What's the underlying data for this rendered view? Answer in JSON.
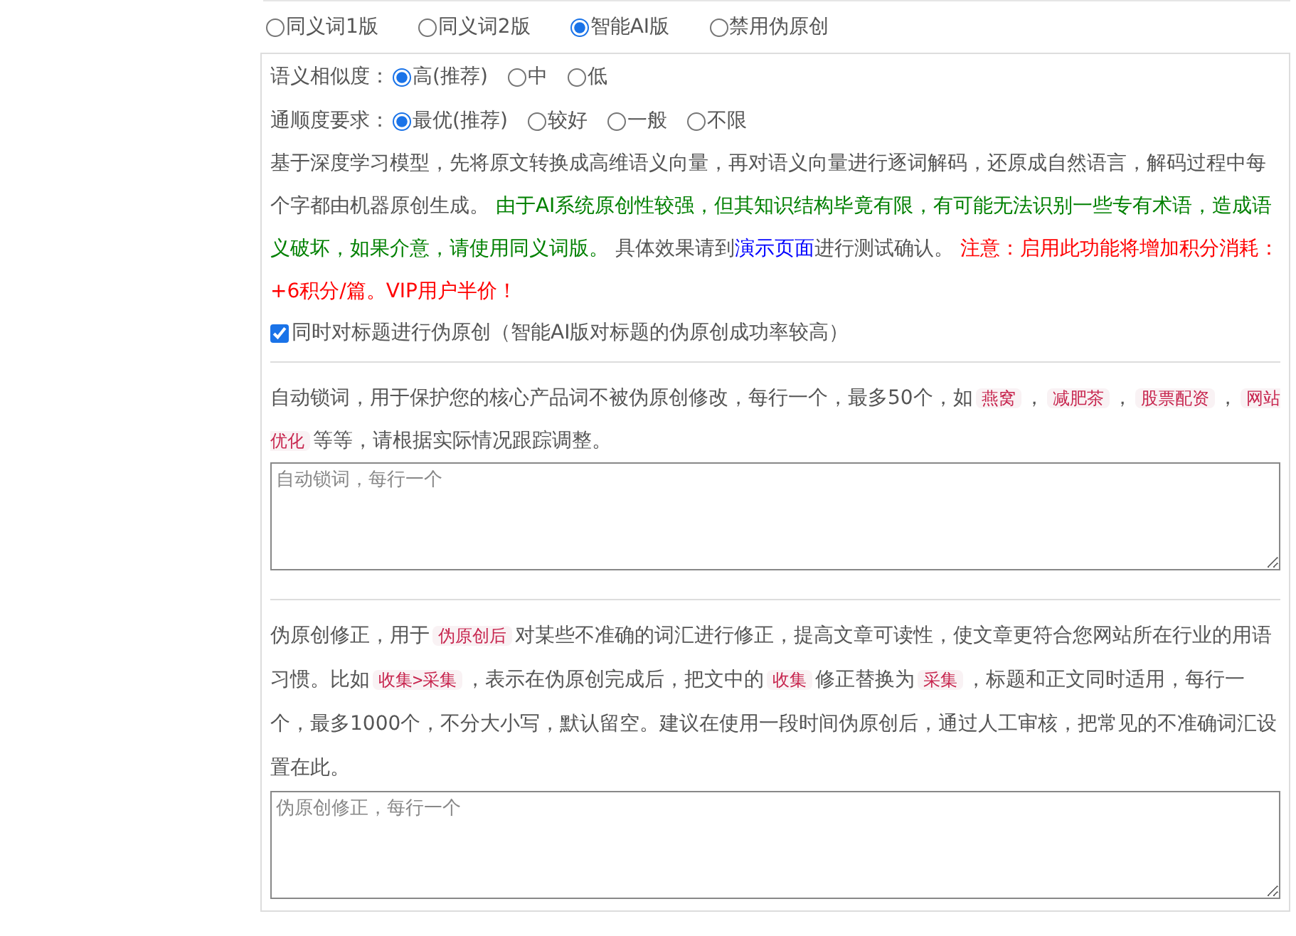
{
  "mode_options": [
    {
      "label": "同义词1版",
      "selected": false
    },
    {
      "label": "同义词2版",
      "selected": false
    },
    {
      "label": "智能AI版",
      "selected": true
    },
    {
      "label": "禁用伪原创",
      "selected": false
    }
  ],
  "similarity": {
    "label": "语义相似度：",
    "options": [
      {
        "label": "高(推荐)",
        "selected": true
      },
      {
        "label": "中",
        "selected": false
      },
      {
        "label": "低",
        "selected": false
      }
    ]
  },
  "fluency": {
    "label": "通顺度要求：",
    "options": [
      {
        "label": "最优(推荐)",
        "selected": true
      },
      {
        "label": "较好",
        "selected": false
      },
      {
        "label": "一般",
        "selected": false
      },
      {
        "label": "不限",
        "selected": false
      }
    ]
  },
  "ai_description": [
    {
      "kind": "plain",
      "text": "基于深度学习模型，先将原文转换成高维语义向量，再对语义向量进行逐词解码，还原成自然语言，解码过程中每个字都由机器原创生成。 "
    },
    {
      "kind": "green",
      "text": "由于AI系统原创性较强，但其知识结构毕竟有限，有可能无法识别一些专有术语，造成语义破坏，如果介意，请使用同义词版。"
    },
    {
      "kind": "plain",
      "text": " 具体效果请到"
    },
    {
      "kind": "link",
      "text": "演示页面"
    },
    {
      "kind": "plain",
      "text": "进行测试确认。 "
    },
    {
      "kind": "red",
      "text": "注意：启用此功能将增加积分消耗：+6积分/篇。VIP用户半价！"
    }
  ],
  "title_checkbox": {
    "label": "同时对标题进行伪原创（智能AI版对标题的伪原创成功率较高）",
    "checked": true
  },
  "lock_words": {
    "description": [
      {
        "kind": "plain",
        "text": "自动锁词，用于保护您的核心产品词不被伪原创修改，每行一个，最多50个，如"
      },
      {
        "kind": "code",
        "text": "燕窝"
      },
      {
        "kind": "plain",
        "text": "，"
      },
      {
        "kind": "code",
        "text": "减肥茶"
      },
      {
        "kind": "plain",
        "text": "，"
      },
      {
        "kind": "code",
        "text": "股票配资"
      },
      {
        "kind": "plain",
        "text": "，"
      },
      {
        "kind": "code",
        "text": "网站优化"
      },
      {
        "kind": "plain",
        "text": "等等，请根据实际情况跟踪调整。"
      }
    ],
    "placeholder": "自动锁词，每行一个"
  },
  "corrections": {
    "description": [
      {
        "kind": "plain",
        "text": "伪原创修正，用于"
      },
      {
        "kind": "code",
        "text": "伪原创后"
      },
      {
        "kind": "plain",
        "text": "对某些不准确的词汇进行修正，提高文章可读性，使文章更符合您网站所在行业的用语习惯。比如"
      },
      {
        "kind": "code",
        "text": "收集>采集"
      },
      {
        "kind": "plain",
        "text": "，表示在伪原创完成后，把文中的"
      },
      {
        "kind": "code",
        "text": "收集"
      },
      {
        "kind": "plain",
        "text": "修正替换为"
      },
      {
        "kind": "code",
        "text": "采集"
      },
      {
        "kind": "plain",
        "text": "，标题和正文同时适用，每行一个，最多1000个，不分大小写，默认留空。建议在使用一段时间伪原创后，通过人工审核，把常见的不准确词汇设置在此。"
      }
    ],
    "placeholder": "伪原创修正，每行一个"
  }
}
